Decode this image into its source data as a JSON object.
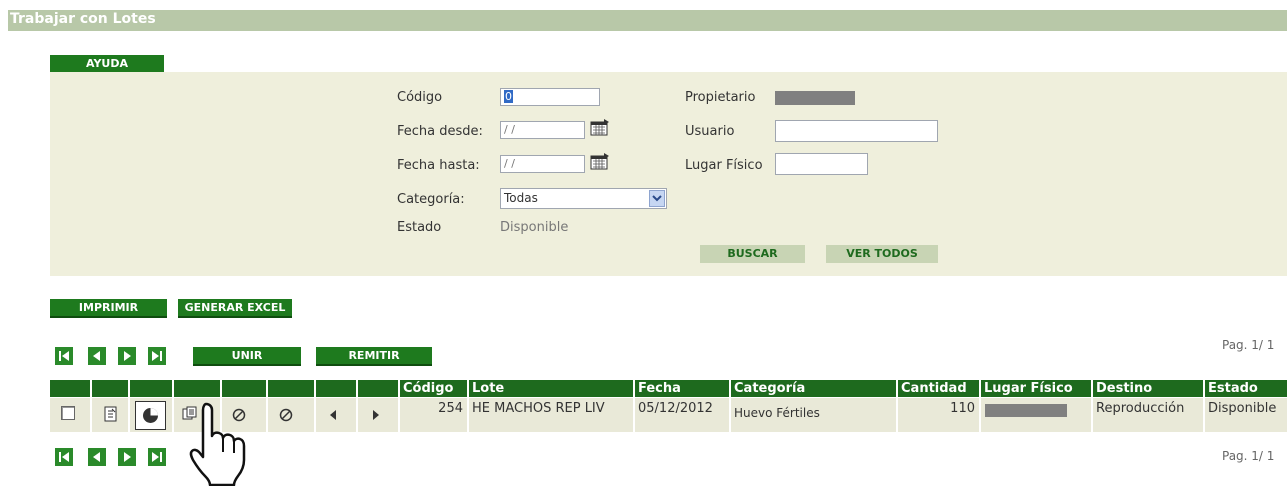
{
  "window": {
    "title": "Trabajar con Lotes"
  },
  "toolbar": {
    "help_label": "AYUDA",
    "print_label": "IMPRIMIR",
    "excel_label": "GENERAR EXCEL",
    "merge_label": "UNIR",
    "send_label": "REMITIR"
  },
  "filters": {
    "codigo_label": "Código",
    "codigo_value": "0",
    "fecha_desde_label": "Fecha desde:",
    "fecha_desde_value": "/ /",
    "fecha_hasta_label": "Fecha hasta:",
    "fecha_hasta_value": "/ /",
    "categoria_label": "Categoría:",
    "categoria_value": "Todas",
    "estado_label": "Estado",
    "estado_value": "Disponible",
    "propietario_label": "Propietario",
    "usuario_label": "Usuario",
    "usuario_value": "",
    "lugar_label": "Lugar Físico",
    "lugar_value": "",
    "search_label": "BUSCAR",
    "view_all_label": "VER TODOS"
  },
  "pagination": {
    "text": "Pag. 1/ 1"
  },
  "table": {
    "columns": [
      "Código",
      "Lote",
      "Fecha",
      "Categoría",
      "Cantidad",
      "Lugar Físico",
      "Destino",
      "Estado"
    ],
    "row": {
      "codigo": "254",
      "lote": "HE MACHOS REP LIV",
      "fecha": "05/12/2012",
      "categoria": "Huevo Fértiles",
      "cantidad": "110",
      "destino": "Reproducción",
      "estado": "Disponible"
    }
  },
  "colors": {
    "accent": "#1e7a1e",
    "title_bar": "#b8c8a8",
    "panel": "#efefdc"
  }
}
